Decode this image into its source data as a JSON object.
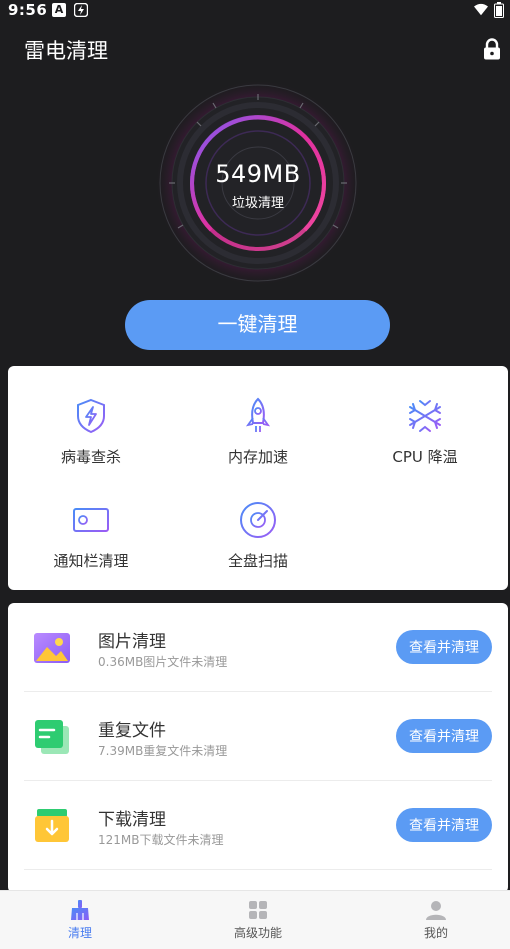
{
  "status_bar": {
    "time": "9:56",
    "notif_a": "A"
  },
  "app": {
    "title": "雷电清理"
  },
  "gauge": {
    "value": "549MB",
    "label": "垃圾清理"
  },
  "primary_action": {
    "label": "一键清理"
  },
  "tools": [
    {
      "label": "病毒查杀",
      "icon": "shield-bolt-icon"
    },
    {
      "label": "内存加速",
      "icon": "rocket-icon"
    },
    {
      "label": "CPU 降温",
      "icon": "snowflake-icon"
    },
    {
      "label": "通知栏清理",
      "icon": "notification-card-icon"
    },
    {
      "label": "全盘扫描",
      "icon": "disk-scan-icon"
    }
  ],
  "clean_items": [
    {
      "title": "图片清理",
      "subtitle": "0.36MB图片文件未清理",
      "button": "查看并清理",
      "icon": "image-icon"
    },
    {
      "title": "重复文件",
      "subtitle": "7.39MB重复文件未清理",
      "button": "查看并清理",
      "icon": "duplicate-files-icon"
    },
    {
      "title": "下载清理",
      "subtitle": "121MB下载文件未清理",
      "button": "查看并清理",
      "icon": "download-box-icon"
    }
  ],
  "tabs": [
    {
      "label": "清理",
      "icon": "broom-icon",
      "active": true
    },
    {
      "label": "高级功能",
      "icon": "grid-icon",
      "active": false
    },
    {
      "label": "我的",
      "icon": "user-icon",
      "active": false
    }
  ],
  "colors": {
    "accent": "#5b9bf4",
    "background": "#1d1d1f",
    "gauge_pink": "#e0309f",
    "gauge_purple": "#7f5cf5",
    "tab_active": "#4a7df0"
  }
}
